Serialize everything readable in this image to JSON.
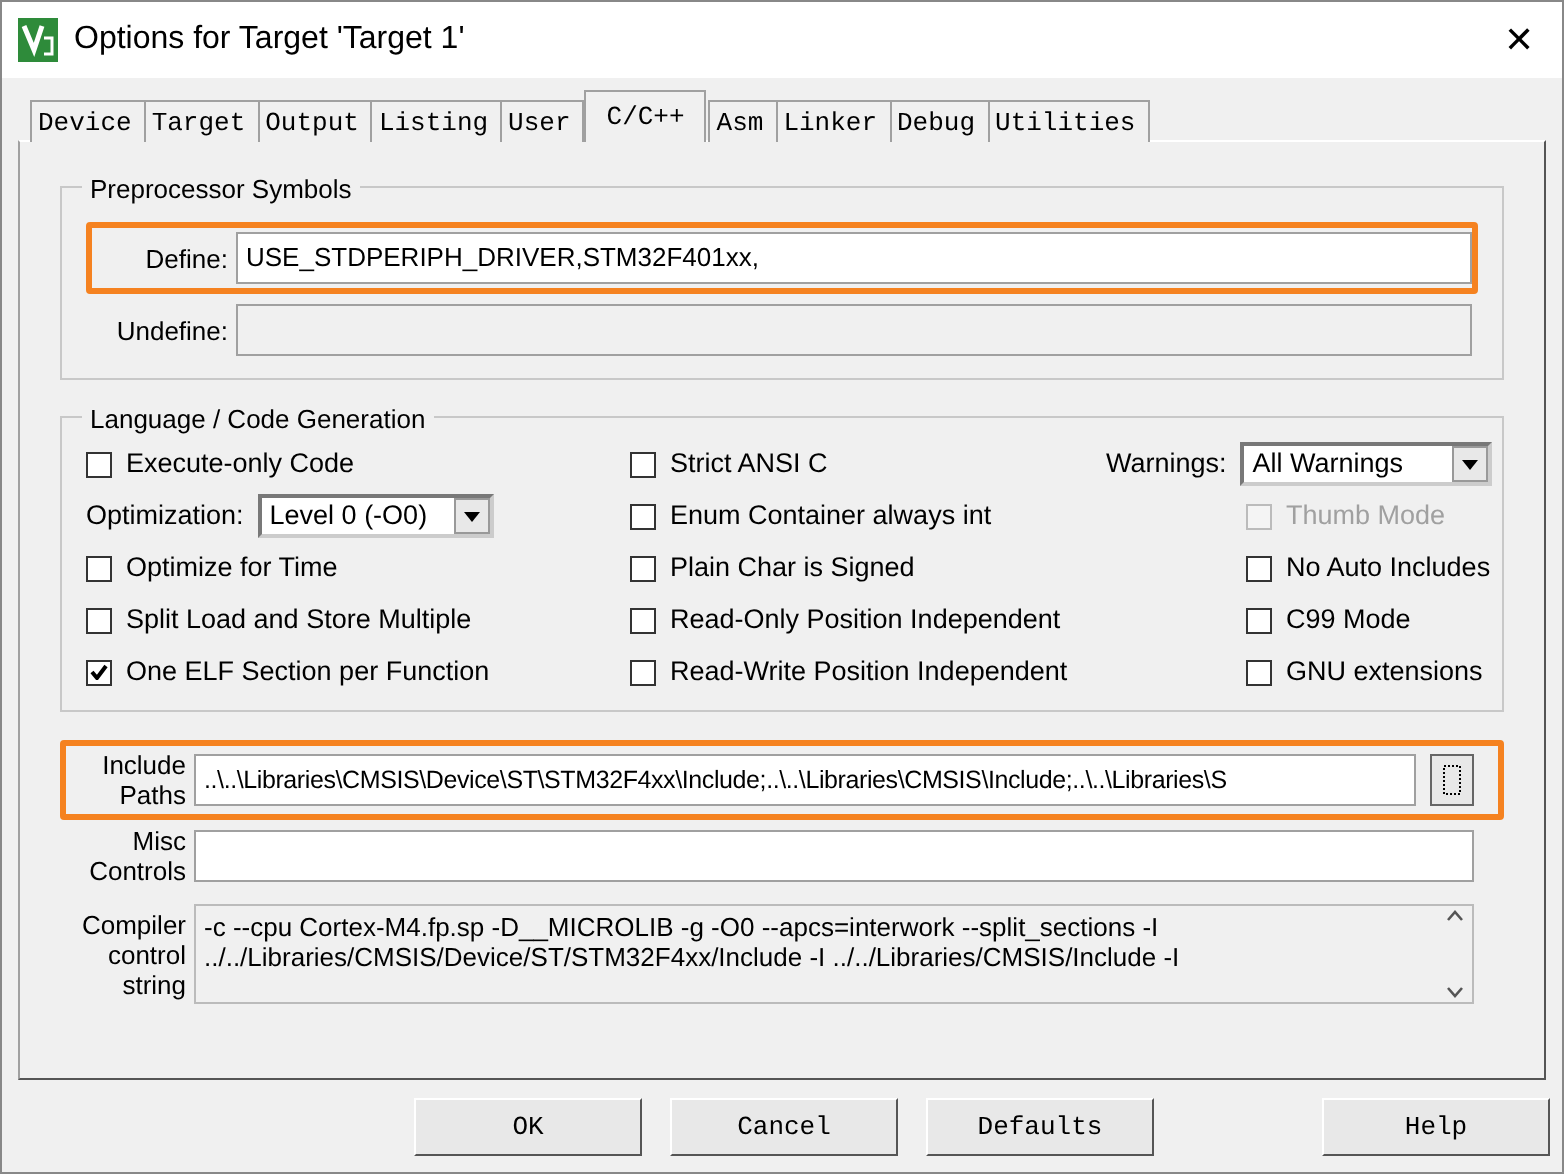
{
  "window": {
    "title": "Options for Target 'Target 1'",
    "close": "✕"
  },
  "tabs": [
    {
      "label": "Device",
      "selected": false
    },
    {
      "label": "Target",
      "selected": false
    },
    {
      "label": "Output",
      "selected": false
    },
    {
      "label": "Listing",
      "selected": false
    },
    {
      "label": "User",
      "selected": false
    },
    {
      "label": "C/C++",
      "selected": true
    },
    {
      "label": "Asm",
      "selected": false
    },
    {
      "label": "Linker",
      "selected": false
    },
    {
      "label": "Debug",
      "selected": false
    },
    {
      "label": "Utilities",
      "selected": false
    }
  ],
  "preprocessor": {
    "title": "Preprocessor Symbols",
    "fields": [
      {
        "label": "Define:",
        "value": "USE_STDPERIPH_DRIVER,STM32F401xx,",
        "disabled": false,
        "highlighted": true
      },
      {
        "label": "Undefine:",
        "disabled": true,
        "highlighted": false
      }
    ]
  },
  "language": {
    "title": "Language / Code Generation",
    "columns": [
      [
        {
          "kind": "checkbox",
          "label": "Execute-only Code",
          "checked": false,
          "disabled": false
        },
        {
          "kind": "select",
          "label": "Optimization:",
          "value": "Level 0 (-O0)"
        },
        {
          "kind": "checkbox",
          "label": "Optimize for Time",
          "checked": false,
          "disabled": false
        },
        {
          "kind": "checkbox",
          "label": "Split Load and Store Multiple",
          "checked": false,
          "disabled": false
        },
        {
          "kind": "checkbox",
          "label": "One ELF Section per Function",
          "checked": true,
          "disabled": false
        }
      ],
      [
        {
          "kind": "checkbox",
          "label": "Strict ANSI C",
          "checked": false,
          "disabled": false
        },
        {
          "kind": "checkbox",
          "label": "Enum Container always int",
          "checked": false,
          "disabled": false
        },
        {
          "kind": "checkbox",
          "label": "Plain Char is Signed",
          "checked": false,
          "disabled": false
        },
        {
          "kind": "checkbox",
          "label": "Read-Only Position Independent",
          "checked": false,
          "disabled": false
        },
        {
          "kind": "checkbox",
          "label": "Read-Write Position Independent",
          "checked": false,
          "disabled": false
        }
      ],
      [
        {
          "kind": "select",
          "label": "Warnings:",
          "value": "All Warnings"
        },
        {
          "kind": "checkbox",
          "label": "Thumb Mode",
          "checked": false,
          "disabled": true
        },
        {
          "kind": "checkbox",
          "label": "No Auto Includes",
          "checked": false,
          "disabled": false
        },
        {
          "kind": "checkbox",
          "label": "C99 Mode",
          "checked": false,
          "disabled": false
        },
        {
          "kind": "checkbox",
          "label": "GNU extensions",
          "checked": false,
          "disabled": false
        }
      ]
    ]
  },
  "include_paths": {
    "label": "Include Paths",
    "value": "..\\..\\Libraries\\CMSIS\\Device\\ST\\STM32F4xx\\Include;..\\..\\Libraries\\CMSIS\\Include;..\\..\\Libraries\\S",
    "highlighted": true
  },
  "misc_controls": {
    "label": "Misc Controls"
  },
  "compiler_string": {
    "label": "Compiler control string",
    "lines": [
      "-c --cpu Cortex-M4.fp.sp -D__MICROLIB -g -O0 --apcs=interwork --split_sections -I",
      "../../Libraries/CMSIS/Device/ST/STM32F4xx/Include -I ../../Libraries/CMSIS/Include -I"
    ]
  },
  "buttons": [
    {
      "label": "OK",
      "kind": "action"
    },
    {
      "label": "Cancel",
      "kind": "action"
    },
    {
      "label": "Defaults",
      "kind": "action"
    },
    {
      "label": "Help",
      "kind": "help"
    }
  ]
}
